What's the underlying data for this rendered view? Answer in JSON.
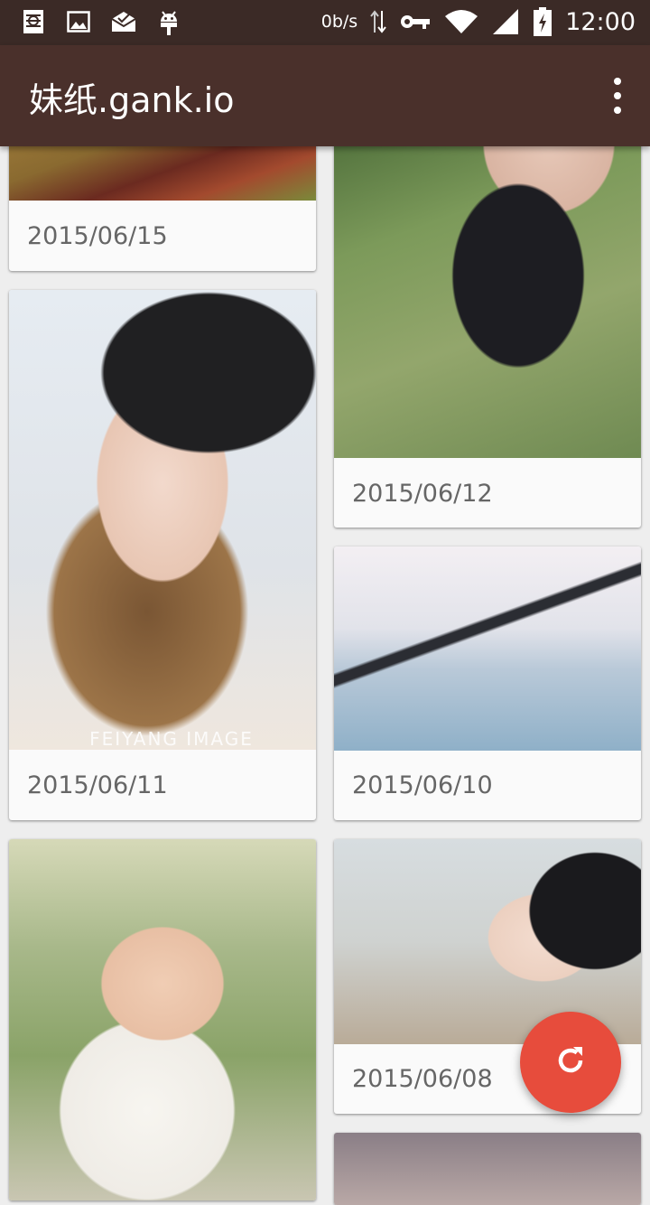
{
  "status_bar": {
    "network_speed": "0b/s",
    "time": "12:00",
    "icons": [
      "app-notification-icon",
      "image-icon",
      "mail-icon",
      "android-icon",
      "data-arrows-icon",
      "vpn-key-icon",
      "wifi-icon",
      "signal-icon",
      "battery-charging-icon"
    ]
  },
  "app_bar": {
    "title": "妹纸.gank.io",
    "overflow_icon": "more-vert-icon"
  },
  "cards": [
    {
      "date": "2015/06/15"
    },
    {
      "date": "2015/06/12"
    },
    {
      "date": "2015/06/11",
      "watermark": "FEIYANG IMAGE"
    },
    {
      "date": "2015/06/10"
    },
    {
      "date": ""
    },
    {
      "date": "2015/06/08"
    },
    {
      "date": ""
    }
  ],
  "fab": {
    "icon": "refresh-icon",
    "color": "#e74c3c"
  },
  "colors": {
    "status_bar": "#3b2a26",
    "app_bar": "#4a302b",
    "accent": "#e74c3c"
  }
}
